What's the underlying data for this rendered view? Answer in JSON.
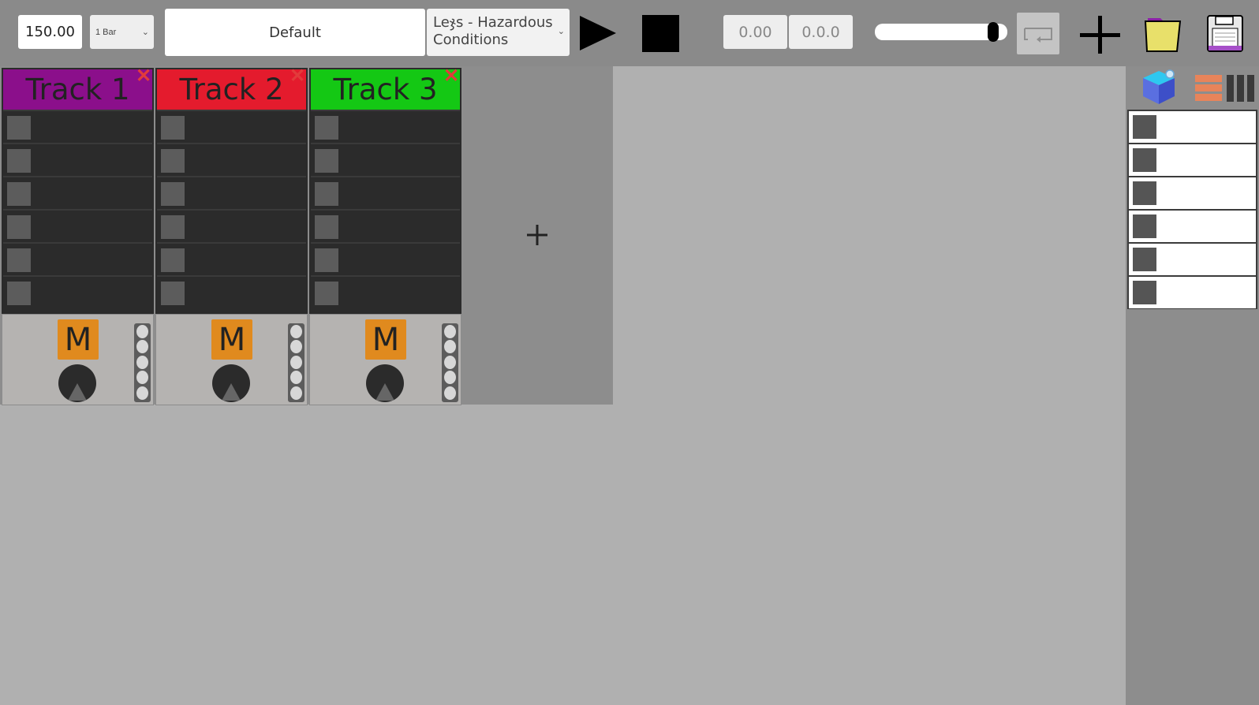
{
  "toolbar": {
    "tempo": "150.00",
    "quantize": "1 Bar",
    "preset": "Default",
    "song": "Leჯs - Hazardous Conditions",
    "position": "0.00",
    "bar_beat": "0.0.0",
    "volume": 0.93
  },
  "tracks": [
    {
      "name": "Track 1",
      "color": "#8b0f8b",
      "mute_label": "M"
    },
    {
      "name": "Track 2",
      "color": "#e41b2d",
      "mute_label": "M"
    },
    {
      "name": "Track 3",
      "color": "#14c814",
      "mute_label": "M"
    }
  ],
  "colors": {
    "mute": "#e08a1e",
    "close": "#e23b3b"
  },
  "icons": [
    "play-icon",
    "stop-icon",
    "loop-icon",
    "plus-icon",
    "folder-icon",
    "save-icon",
    "cube-icon",
    "list-view-icon",
    "columns-view-icon",
    "close-icon"
  ]
}
